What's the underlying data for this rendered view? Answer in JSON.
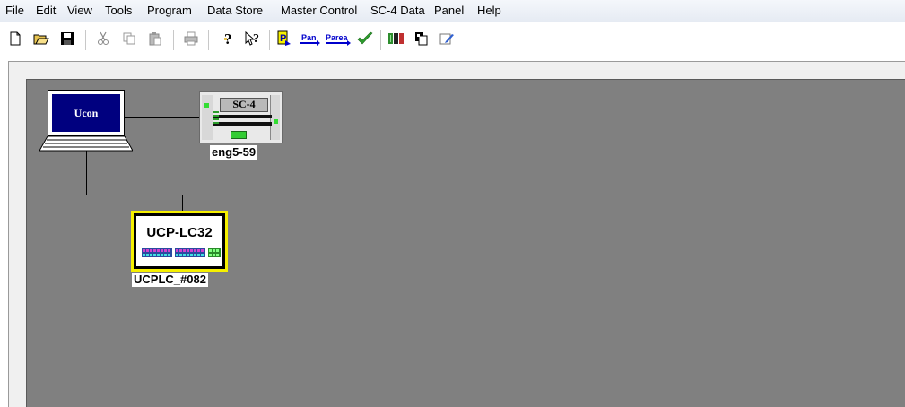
{
  "menu": [
    "File",
    "Edit",
    "View",
    "Tools",
    "Program",
    "Data Store",
    "Master Control",
    "SC-4 Data",
    "Panel",
    "Help"
  ],
  "toolbar": {
    "pan_label": "Pan",
    "parea_label": "Parea"
  },
  "icons": {
    "new": "new-file-icon",
    "open": "open-folder-icon",
    "save": "save-disk-icon",
    "cut": "cut-icon",
    "copy": "copy-icon",
    "paste": "paste-icon",
    "print": "print-icon",
    "help": "help-icon",
    "context_help": "context-help-icon",
    "check": "checkmark-icon"
  },
  "devices": {
    "laptop": {
      "screen_text": "Ucon"
    },
    "sc4": {
      "title": "SC-4",
      "label": "eng5-59"
    },
    "ucp": {
      "title": "UCP-LC32",
      "label": "UCPLC_#082"
    }
  },
  "colors": {
    "canvas": "#808080",
    "laptop_screen": "#00007f",
    "ucp_border": "#f6f000",
    "check": "#2e9d2e",
    "pan": "#0000cc"
  }
}
